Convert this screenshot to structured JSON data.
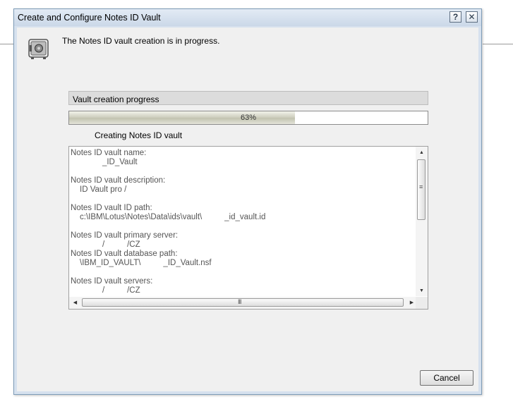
{
  "dialog": {
    "title": "Create and Configure Notes ID Vault",
    "help_glyph": "?",
    "close_glyph": "✕"
  },
  "status": {
    "message": "The Notes ID vault creation is in progress.",
    "icon": "vault-safe-icon"
  },
  "progress": {
    "header": "Vault creation progress",
    "percent_text": "63%",
    "value_fraction": 0.63,
    "step_message": "Creating Notes ID vault"
  },
  "log": {
    "entries": [
      {
        "label": "Notes ID vault name:",
        "value": "          _ID_Vault"
      },
      {
        "label": "Notes ID vault description:",
        "value": "ID Vault pro /"
      },
      {
        "label": "Notes ID vault ID path:",
        "value": "c:\\IBM\\Lotus\\Notes\\Data\\ids\\vault\\          _id_vault.id"
      },
      {
        "label": "Notes ID vault primary server:",
        "value": "          /          /CZ"
      },
      {
        "label": "Notes ID vault database path:",
        "value": "\\IBM_ID_VAULT\\          _ID_Vault.nsf"
      },
      {
        "label": "Notes ID vault servers:",
        "value": "          /          /CZ"
      }
    ]
  },
  "scrollbar": {
    "up_glyph": "▲",
    "down_glyph": "▼",
    "left_glyph": "◀",
    "right_glyph": "▶",
    "grip": "≡",
    "hgrip": "III"
  },
  "buttons": {
    "cancel": "Cancel"
  },
  "colors": {
    "window_frame": "#d6e1ee",
    "client_bg": "#f0f0f0",
    "progress_fill": "#cfd0c0"
  }
}
